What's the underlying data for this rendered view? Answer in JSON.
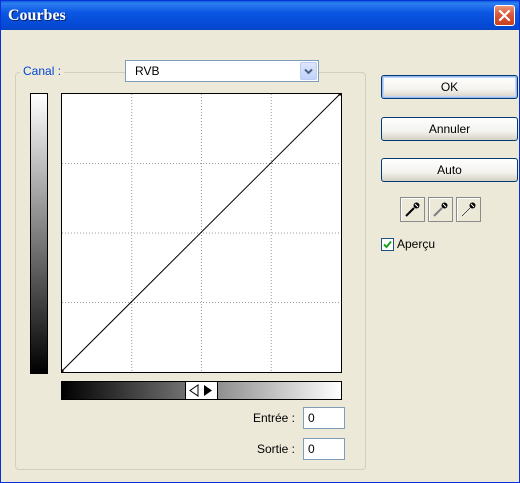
{
  "window": {
    "title": "Courbes"
  },
  "channel": {
    "label": "Canal :",
    "value": "RVB"
  },
  "curve": {
    "grid_divisions": 4,
    "points": [
      [
        0,
        0
      ],
      [
        255,
        255
      ]
    ]
  },
  "inputs": {
    "input_label": "Entrée :",
    "input_value": "0",
    "output_label": "Sortie :",
    "output_value": "0"
  },
  "buttons": {
    "ok": "OK",
    "cancel": "Annuler",
    "auto": "Auto"
  },
  "eyedroppers": [
    "black-eyedropper-icon",
    "gray-eyedropper-icon",
    "white-eyedropper-icon"
  ],
  "preview": {
    "label": "Aperçu",
    "checked": true
  },
  "colors": {
    "title_bar": "#0b56e3",
    "group_label": "#0046d5",
    "close": "#d9573a"
  }
}
